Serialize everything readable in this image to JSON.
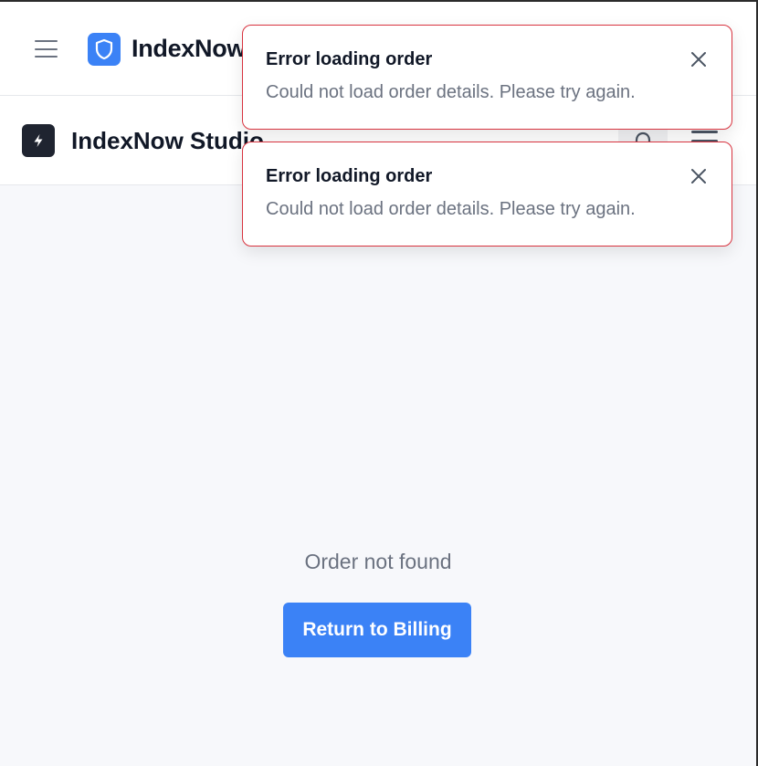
{
  "header": {
    "brand_name": "IndexNow",
    "menu_icon": "hamburger-menu-icon",
    "brand_icon": "shield-icon"
  },
  "subheader": {
    "studio_name": "IndexNow Studio",
    "studio_icon": "lightning-bolt-icon",
    "action_icon": "bell-icon",
    "menu_icon": "hamburger-menu-icon"
  },
  "toasts": [
    {
      "title": "Error loading order",
      "message": "Could not load order details. Please try again.",
      "close_icon": "close-icon"
    },
    {
      "title": "Error loading order",
      "message": "Could not load order details. Please try again.",
      "close_icon": "close-icon"
    }
  ],
  "main": {
    "status_text": "Order not found",
    "return_button_label": "Return to Billing"
  },
  "colors": {
    "accent": "#3b82f6",
    "error_border": "#d8333f",
    "dark_icon_bg": "#1f2430",
    "page_bg": "#f7f8fb"
  }
}
